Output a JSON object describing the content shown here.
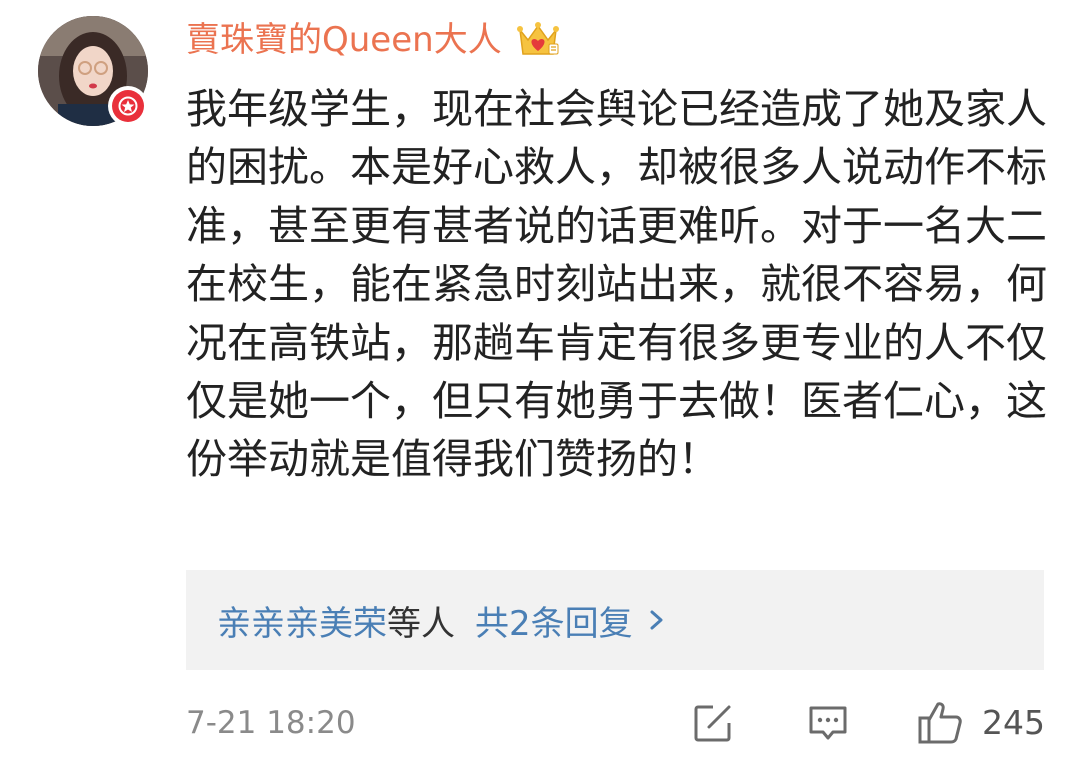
{
  "author": {
    "name": "賣珠寶的Queen大人",
    "name_color": "#eb7350",
    "badge_icon": "crown-heart-icon",
    "verified_icon": "red-star-verified-icon"
  },
  "comment": {
    "text": "我年级学生，现在社会舆论已经造成了她及家人的困扰。本是好心救人，却被很多人说动作不标准，甚至更有甚者说的话更难听。对于一名大二在校生，能在紧急时刻站出来，就很不容易，何况在高铁站，那趟车肯定有很多更专业的人不仅仅是她一个，但只有她勇于去做！医者仁心，这份举动就是值得我们赞扬的！"
  },
  "replies": {
    "names": "亲亲亲美荣",
    "mid_text": "等人",
    "count_text": "共2条回复",
    "link_color": "#4a7fb5"
  },
  "footer": {
    "timestamp": "7-21 18:20",
    "like_count": "245",
    "icons": [
      "edit-icon",
      "comment-icon",
      "thumbs-up-icon"
    ]
  }
}
